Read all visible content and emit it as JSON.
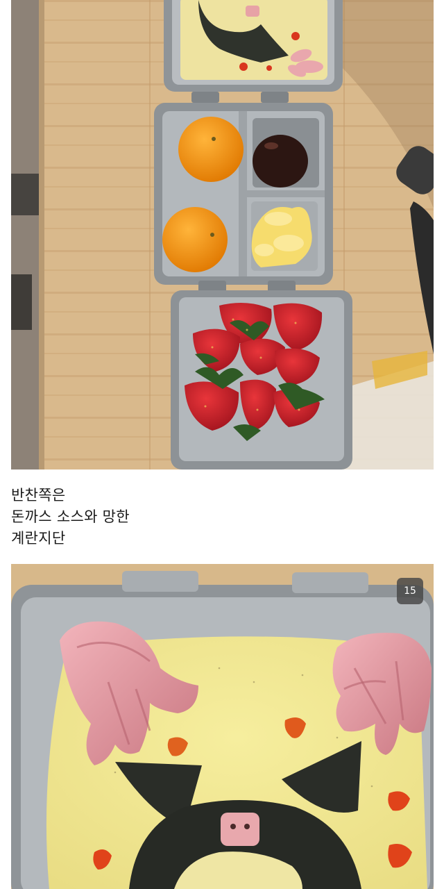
{
  "caption": {
    "lines": [
      "반찬쪽은",
      "돈까스 소스와 망한",
      "계란지단"
    ]
  },
  "photo2": {
    "badge": "15"
  },
  "icons": {
    "photo1": "lunchbox-photo",
    "photo2": "kuromi-omelette-photo"
  }
}
